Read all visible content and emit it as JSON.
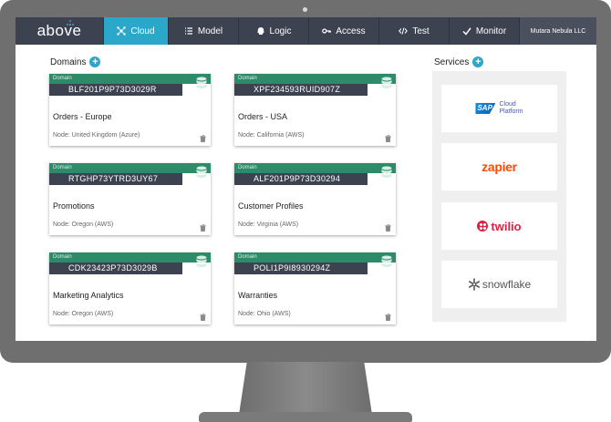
{
  "brand": {
    "logo": "above",
    "accent": "#2aa7c9",
    "domain_green": "#2e8b6a",
    "nav_bg": "#3d4250"
  },
  "nav": {
    "tabs": [
      {
        "label": "Cloud",
        "icon": "cloud-network-icon",
        "active": true
      },
      {
        "label": "Model",
        "icon": "list-icon",
        "active": false
      },
      {
        "label": "Logic",
        "icon": "brain-icon",
        "active": false
      },
      {
        "label": "Access",
        "icon": "key-icon",
        "active": false
      },
      {
        "label": "Test",
        "icon": "code-icon",
        "active": false
      },
      {
        "label": "Monitor",
        "icon": "check-icon",
        "active": false
      }
    ],
    "user": "Mutara Nebula LLC"
  },
  "domains_title": "Domains",
  "services_title": "Services",
  "domains": [
    {
      "tag": "Domain",
      "id": "BLF201P9P73D3029R",
      "name": "Orders - Europe",
      "node": "Node: United Kingdom (Azure)"
    },
    {
      "tag": "Domain",
      "id": "XPF234593RUID907Z",
      "name": "Orders - USA",
      "node": "Node: California (AWS)"
    },
    {
      "tag": "Domain",
      "id": "RTGHP73YTRD3UY67",
      "name": "Promotions",
      "node": "Node: Oregon (AWS)"
    },
    {
      "tag": "Domain",
      "id": "ALF201P9P73D30294",
      "name": "Customer Profiles",
      "node": "Node: Virginia (AWS)"
    },
    {
      "tag": "Domain",
      "id": "CDK23423P73D3029B",
      "name": "Marketing Analytics",
      "node": "Node: Oregon (AWS)"
    },
    {
      "tag": "Domain",
      "id": "POLI1P9I8930294Z",
      "name": "Warranties",
      "node": "Node: Ohio (AWS)"
    }
  ],
  "services": {
    "sap": {
      "mark": "SAP",
      "line1": "Cloud",
      "line2": "Platform"
    },
    "zapier": "zapier",
    "twilio": "twilio",
    "snowflake": "snowflake"
  }
}
